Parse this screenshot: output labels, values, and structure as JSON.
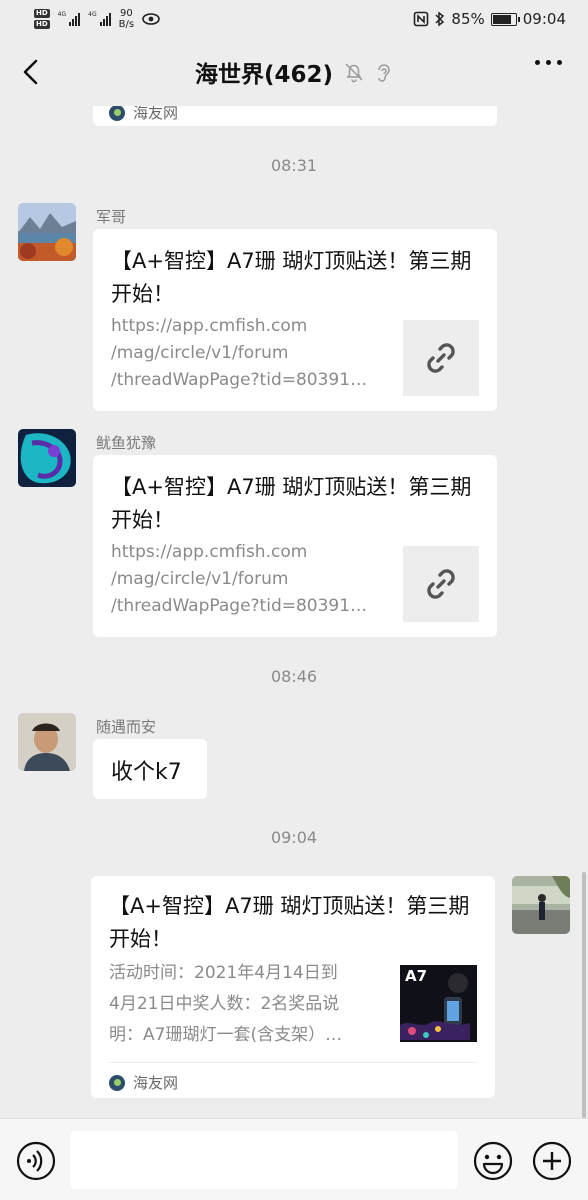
{
  "status_bar": {
    "hd1": "HD",
    "hd2": "HD",
    "net1": "4G",
    "net2": "4G",
    "speed_value": "90",
    "speed_unit": "B/s",
    "battery": "85%",
    "battery_level": 0.85,
    "time": "09:04"
  },
  "nav": {
    "title": "海世界(462)"
  },
  "chat": {
    "top_source": "海友网",
    "timestamps": [
      "08:31",
      "08:46",
      "09:04"
    ],
    "messages": [
      {
        "sender": "军哥",
        "title": "【A+智控】A7珊 瑚灯顶贴送！第三期开始！",
        "desc_line1": "https://app.cmfish.com",
        "desc_line2": "/mag/circle/v1/forum",
        "desc_line3": "/threadWapPage?tid=80391…"
      },
      {
        "sender": "鱿鱼犹豫",
        "title": "【A+智控】A7珊 瑚灯顶贴送！第三期开始！",
        "desc_line1": "https://app.cmfish.com",
        "desc_line2": "/mag/circle/v1/forum",
        "desc_line3": "/threadWapPage?tid=80391…"
      },
      {
        "sender": "随遇而安",
        "text": "收个k7"
      },
      {
        "title": "【A+智控】A7珊 瑚灯顶贴送！第三期开始！",
        "desc_line1": "活动时间：2021年4月14日到",
        "desc_line2": "4月21日中奖人数：2名奖品说",
        "desc_line3": "明：A7珊瑚灯一套(含支架）…",
        "thumb_label": "A7",
        "source": "海友网"
      }
    ]
  },
  "colors": {
    "background": "#ededed",
    "bubble": "#ffffff",
    "meta_text": "#8a8a8a"
  },
  "icons": {
    "back": "chevron-left-icon",
    "mute": "bell-off-icon",
    "ear": "ear-icon",
    "more": "more-dots-icon",
    "voice": "voice-icon",
    "emoji": "emoji-icon",
    "add": "plus-icon",
    "link": "link-icon"
  }
}
